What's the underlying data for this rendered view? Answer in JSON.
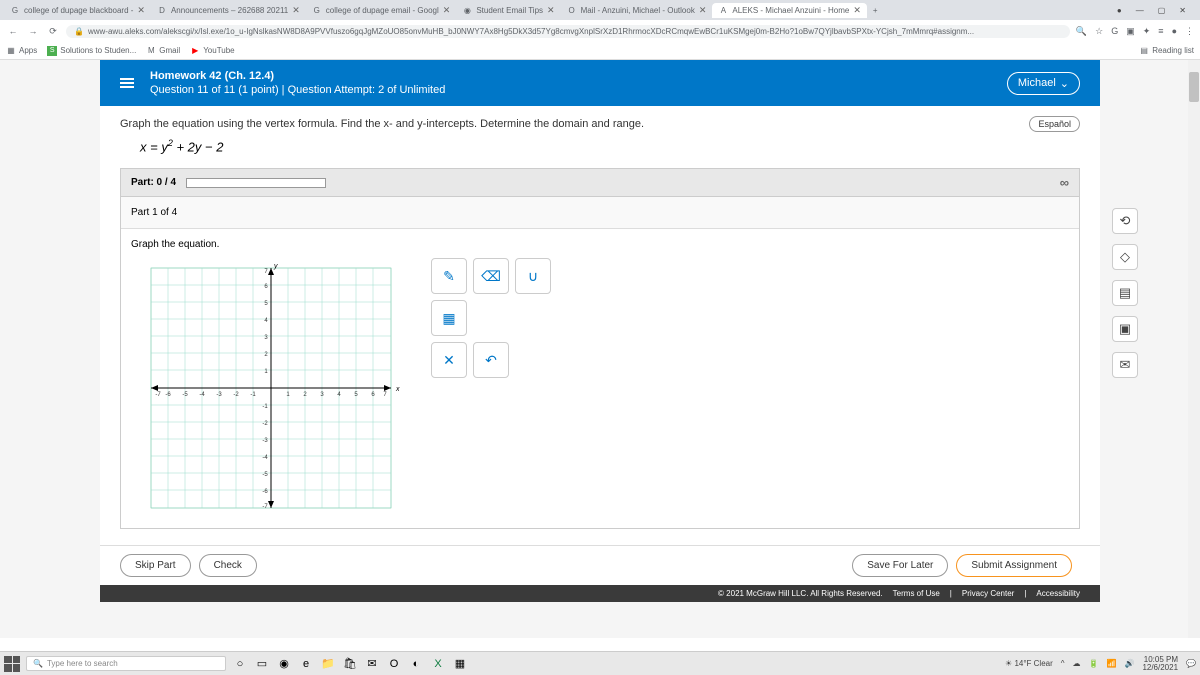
{
  "browser": {
    "tabs": [
      {
        "icon": "G",
        "label": "college of dupage blackboard - "
      },
      {
        "icon": "D",
        "label": "Announcements – 262688 20211"
      },
      {
        "icon": "G",
        "label": "college of dupage email - Googl"
      },
      {
        "icon": "◉",
        "label": "Student Email Tips"
      },
      {
        "icon": "O",
        "label": "Mail - Anzuini, Michael - Outlook"
      },
      {
        "icon": "A",
        "label": "ALEKS - Michael Anzuini - Home",
        "active": true
      }
    ],
    "url": "www-awu.aleks.com/alekscgi/x/Isl.exe/1o_u-IgNslkasNW8D8A9PVVfuszo6gqJgMZoUO85onvMuHB_bJ0NWY7Ax8Hg5DkX3d57Yg8cmvgXnplSrXzD1RhrmocXDcRCmqwEwBCr1uKSMgej0m-B2Ho?1oBw7QYjlbavbSPXtx-YCjsh_7mMmrq#assignm...",
    "reading_list": "Reading list"
  },
  "bookmarks": {
    "apps": "Apps",
    "items": [
      "Solutions to Studen...",
      "Gmail",
      "YouTube"
    ]
  },
  "header": {
    "hw_title": "Homework 42 (Ch. 12.4)",
    "question_line": "Question 11 of 11 (1 point)   |   Question Attempt: 2 of Unlimited",
    "user": "Michael"
  },
  "question": {
    "lang": "Español",
    "prompt": "Graph the equation using the vertex formula. Find the x- and y-intercepts. Determine the domain and range.",
    "equation_html": "x = y<sup>2</sup> + 2y − 2"
  },
  "parts": {
    "header": "Part: 0 / 4",
    "label": "Part 1 of 4",
    "instruction": "Graph the equation."
  },
  "chart_data": {
    "type": "scatter",
    "title": "",
    "xlabel": "x",
    "ylabel": "y",
    "xlim": [
      -7,
      7
    ],
    "ylim": [
      -7,
      7
    ],
    "grid": true,
    "series": []
  },
  "tools": {
    "pencil": "✎",
    "eraser": "⌫",
    "curve": "∪",
    "fill": "▦",
    "clear": "✕",
    "undo": "↶"
  },
  "side_tools": [
    "⟲",
    "◇",
    "▤",
    "▣",
    "✉"
  ],
  "actions": {
    "skip": "Skip Part",
    "check": "Check",
    "save": "Save For Later",
    "submit": "Submit Assignment"
  },
  "footer": {
    "copyright": "© 2021 McGraw Hill LLC. All Rights Reserved.",
    "links": [
      "Terms of Use",
      "Privacy Center",
      "Accessibility"
    ]
  },
  "taskbar": {
    "search_placeholder": "Type here to search",
    "weather": "14°F Clear",
    "time": "10:05 PM",
    "date": "12/6/2021"
  }
}
